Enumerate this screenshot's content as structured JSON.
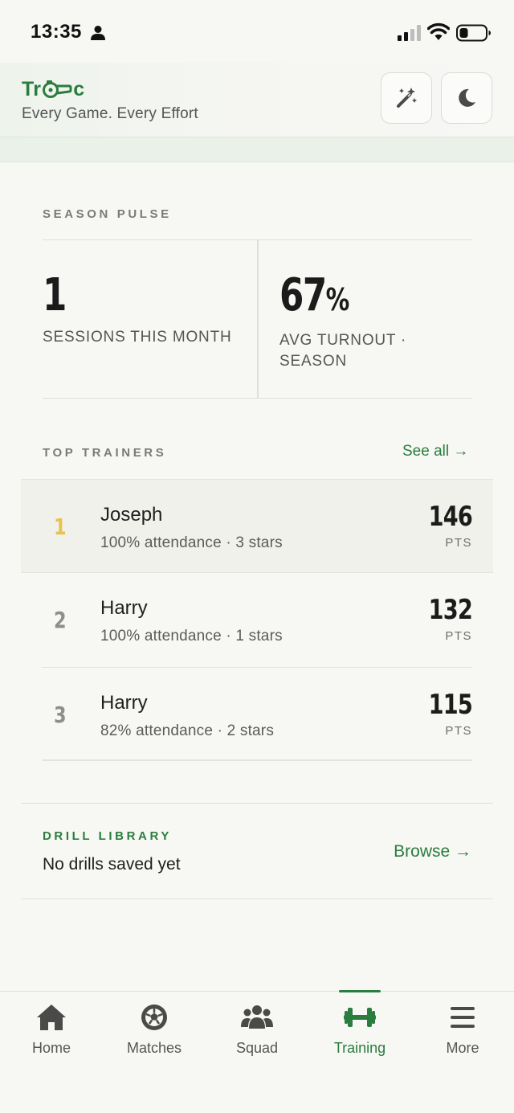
{
  "status_bar": {
    "time": "13:35",
    "icons": [
      "person-icon",
      "signal-icon",
      "wifi-icon",
      "battery-icon"
    ]
  },
  "header": {
    "brand_prefix": "Tr",
    "brand_suffix": "c",
    "tagline": "Every Game. Every Effort",
    "actions": [
      "magic-wand-icon",
      "moon-icon"
    ]
  },
  "season_pulse": {
    "label": "SEASON PULSE",
    "sessions_value": "1",
    "sessions_caption": "SESSIONS THIS MONTH",
    "turnout_value": "67",
    "turnout_unit": "%",
    "turnout_caption": "AVG TURNOUT · SEASON"
  },
  "top_trainers": {
    "label": "TOP TRAINERS",
    "see_all": "See all →",
    "rows": [
      {
        "rank": "1",
        "name": "Joseph",
        "meta": "100% attendance · 3 stars",
        "points": "146",
        "unit": "PTS"
      },
      {
        "rank": "2",
        "name": "Harry",
        "meta": "100% attendance · 1 stars",
        "points": "132",
        "unit": "PTS"
      },
      {
        "rank": "3",
        "name": "Harry",
        "meta": "82% attendance · 2 stars",
        "points": "115",
        "unit": "PTS"
      }
    ]
  },
  "drill_library": {
    "label": "DRILL LIBRARY",
    "status": "No drills saved yet",
    "browse": "Browse →"
  },
  "bottom_nav": {
    "items": [
      {
        "label": "Home",
        "icon": "home-icon"
      },
      {
        "label": "Matches",
        "icon": "soccer-ball-icon"
      },
      {
        "label": "Squad",
        "icon": "users-icon"
      },
      {
        "label": "Training",
        "icon": "dumbbell-icon",
        "active": true
      },
      {
        "label": "More",
        "icon": "menu-icon"
      }
    ]
  },
  "colors": {
    "accent": "#2a7d3e",
    "gold": "#e6c34a",
    "background": "#f7f7f4",
    "nav_icon": "#4a4a48"
  }
}
